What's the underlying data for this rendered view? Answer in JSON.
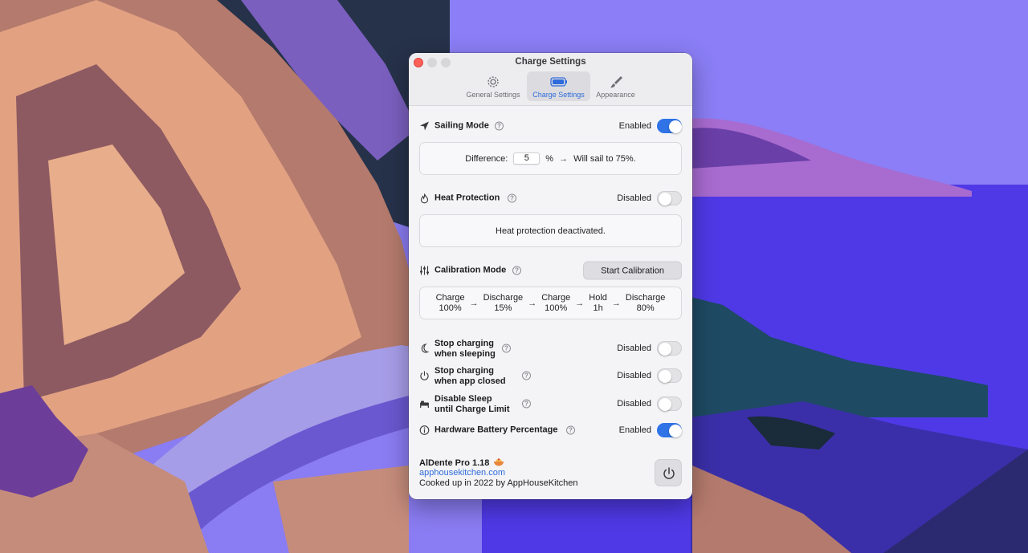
{
  "window": {
    "title": "Charge Settings",
    "tabs": [
      {
        "label": "General Settings",
        "icon": "gear-icon"
      },
      {
        "label": "Charge Settings",
        "icon": "battery-icon"
      },
      {
        "label": "Appearance",
        "icon": "paintbrush-icon"
      }
    ],
    "active_tab": "Charge Settings"
  },
  "sailing": {
    "label": "Sailing Mode",
    "state": "Enabled",
    "enabled": true,
    "difference_label": "Difference:",
    "difference_value": "5",
    "unit": "%",
    "result": "Will sail to 75%."
  },
  "heat": {
    "label": "Heat Protection",
    "state": "Disabled",
    "enabled": false,
    "message": "Heat protection deactivated."
  },
  "calibration": {
    "label": "Calibration Mode",
    "button": "Start Calibration",
    "steps": [
      {
        "name": "Charge",
        "value": "100%"
      },
      {
        "name": "Discharge",
        "value": "15%"
      },
      {
        "name": "Charge",
        "value": "100%"
      },
      {
        "name": "Hold",
        "value": "1h"
      },
      {
        "name": "Discharge",
        "value": "80%"
      }
    ]
  },
  "options": [
    {
      "line1": "Stop charging",
      "line2": "when sleeping",
      "icon": "moon-icon",
      "state": "Disabled",
      "enabled": false
    },
    {
      "line1": "Stop charging",
      "line2": "when app closed",
      "icon": "power-icon",
      "state": "Disabled",
      "enabled": false
    },
    {
      "line1": "Disable Sleep",
      "line2": "until Charge Limit",
      "icon": "bed-icon",
      "state": "Disabled",
      "enabled": false
    },
    {
      "line1": "Hardware Battery Percentage",
      "line2": "",
      "icon": "info-icon",
      "state": "Enabled",
      "enabled": true
    }
  ],
  "footer": {
    "app_name": "AlDente Pro 1.18",
    "emoji_icon": "pasta-bowl-icon",
    "link": "apphousekitchen.com",
    "credit": "Cooked up in 2022 by AppHouseKitchen"
  },
  "colors": {
    "accent": "#2f73e6",
    "link": "#2f6bdb",
    "close": "#fe5f57"
  }
}
